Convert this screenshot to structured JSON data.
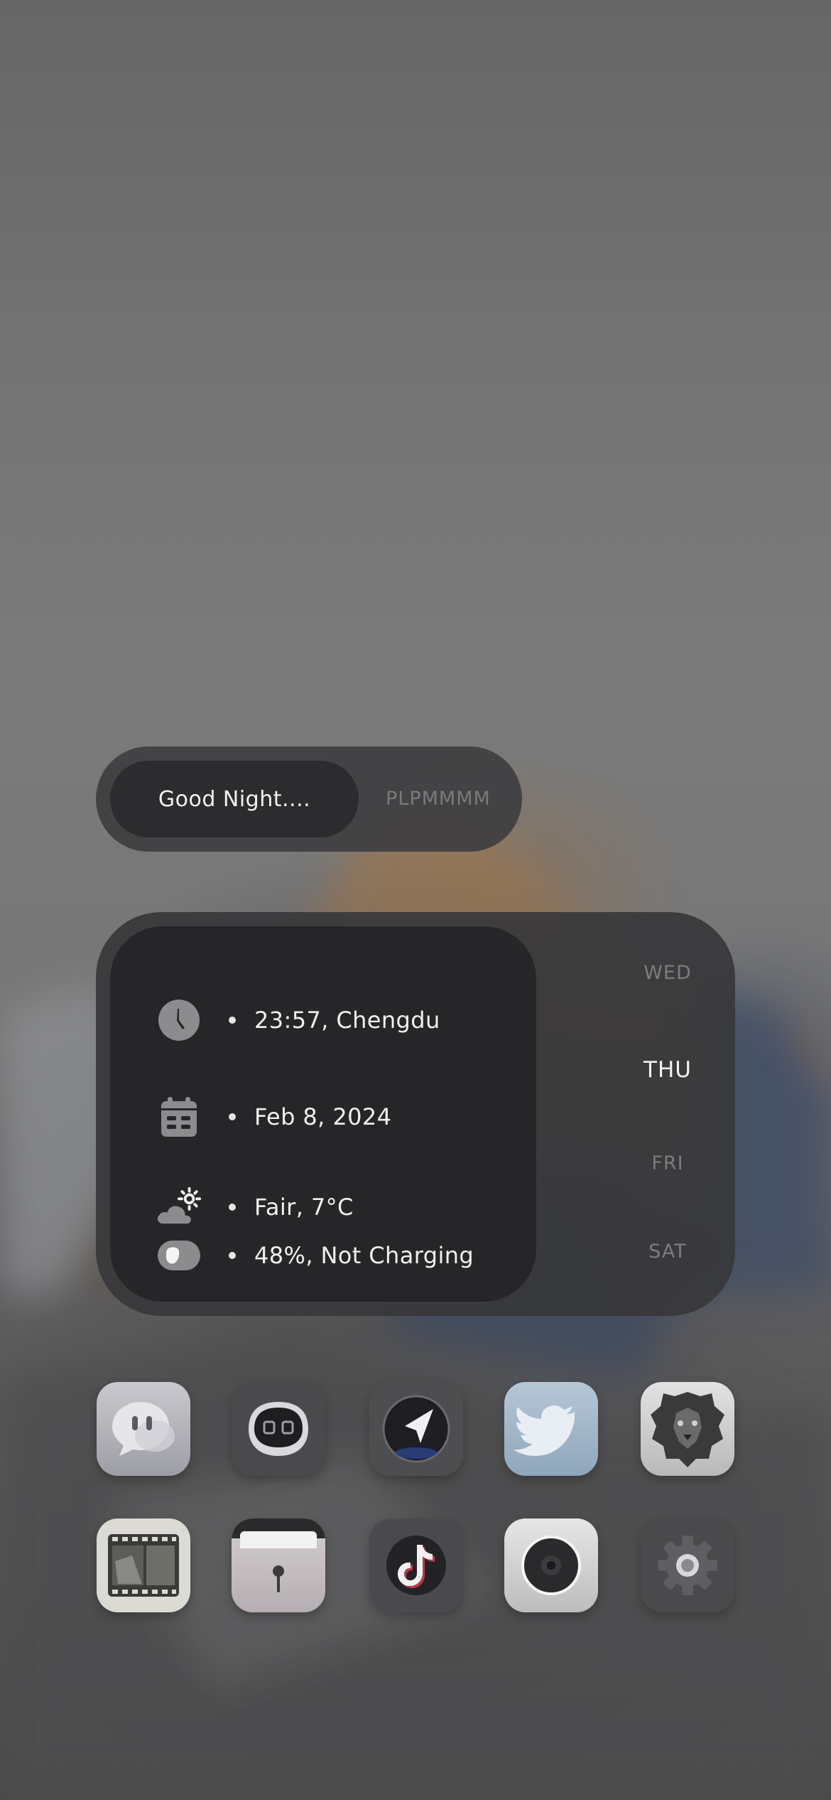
{
  "greeting": {
    "title": "Good Night....",
    "marquee": "PLPMMMM"
  },
  "info": {
    "rows": [
      {
        "icon": "clock-icon",
        "text": "23:57, Chengdu"
      },
      {
        "icon": "calendar-icon",
        "text": "Feb 8, 2024"
      },
      {
        "icon": "weather-cloud-sun-icon",
        "text": "Fair, 7°C"
      },
      {
        "icon": "battery-icon",
        "text": "48%, Not Charging"
      }
    ],
    "days": [
      "WED",
      "THU",
      "FRI",
      "SAT"
    ],
    "active_day": "THU"
  },
  "apps": {
    "row1": [
      {
        "name": "chat-app",
        "icon": "chat-bubble-icon"
      },
      {
        "name": "robot-app",
        "icon": "robot-face-icon"
      },
      {
        "name": "navigation-app",
        "icon": "navigation-arrow-icon"
      },
      {
        "name": "twitter-app",
        "icon": "twitter-bird-icon"
      },
      {
        "name": "lion-app",
        "icon": "lion-head-icon"
      }
    ],
    "row2": [
      {
        "name": "film-app",
        "icon": "film-strip-icon"
      },
      {
        "name": "wallet-app",
        "icon": "wallet-icon"
      },
      {
        "name": "tiktok-app",
        "icon": "tiktok-note-icon"
      },
      {
        "name": "speaker-app",
        "icon": "speaker-icon"
      },
      {
        "name": "settings-app",
        "icon": "gear-icon"
      }
    ]
  },
  "colors": {
    "widget_outer": "#3e3e40",
    "widget_inner": "#262628",
    "text_primary": "#f0f0f0",
    "text_muted": "#7c7c7e"
  }
}
